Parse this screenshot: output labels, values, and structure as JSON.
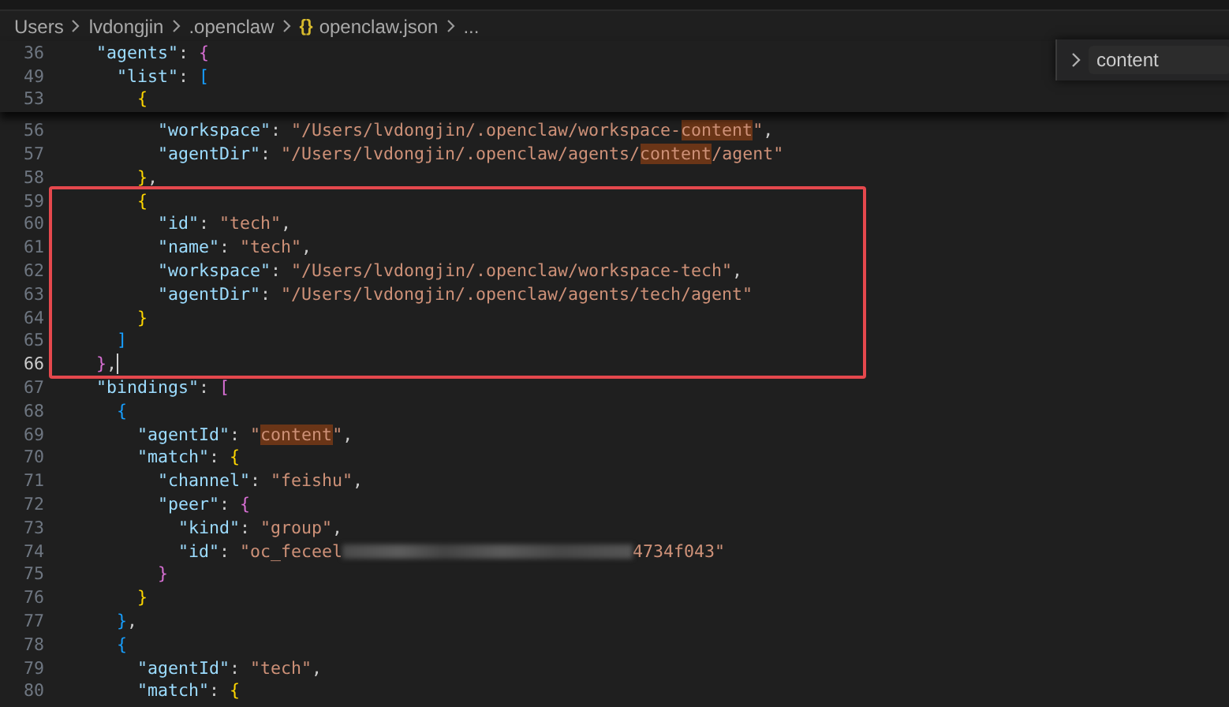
{
  "breadcrumbs": {
    "items": [
      "Users",
      "lvdongjin",
      ".openclaw"
    ],
    "file_icon": "{}",
    "file": "openclaw.json",
    "more": "..."
  },
  "find_widget": {
    "value": "content"
  },
  "sticky_scroll": [
    {
      "number": "36",
      "tokens": [
        {
          "kind": "key",
          "text": "\"agents\""
        },
        {
          "kind": "p",
          "text": ":"
        },
        {
          "kind": "b2",
          "text": "{"
        }
      ]
    },
    {
      "number": "49",
      "tokens": [
        {
          "kind": "key",
          "text": "\"list\""
        },
        {
          "kind": "p",
          "text": ":"
        },
        {
          "kind": "b3",
          "text": "["
        }
      ]
    },
    {
      "number": "53",
      "tokens": [
        {
          "kind": "b1",
          "text": "{"
        }
      ]
    }
  ],
  "lines_above_frame": [
    {
      "number": "56",
      "current": false,
      "tokens": [
        {
          "kind": "key",
          "text": "\"workspace\""
        },
        {
          "kind": "p",
          "text": ":"
        },
        {
          "kind": "str",
          "text": "\"/Users/lvdongjin/.openclaw/workspace-"
        },
        {
          "kind": "match",
          "text": "content"
        },
        {
          "kind": "str",
          "text": "\""
        },
        {
          "kind": "p",
          "text": ","
        }
      ]
    },
    {
      "number": "57",
      "current": false,
      "tokens": [
        {
          "kind": "key",
          "text": "\"agentDir\""
        },
        {
          "kind": "p",
          "text": ":"
        },
        {
          "kind": "str",
          "text": "\"/Users/lvdongjin/.openclaw/agents/"
        },
        {
          "kind": "match",
          "text": "content"
        },
        {
          "kind": "str",
          "text": "/agent\""
        }
      ]
    },
    {
      "number": "58",
      "current": false,
      "tokens": [
        {
          "kind": "b1",
          "text": "}"
        },
        {
          "kind": "p",
          "text": ","
        }
      ]
    }
  ],
  "framed_lines": [
    {
      "number": "59",
      "current": false,
      "tokens": [
        {
          "kind": "b1",
          "text": "{"
        }
      ]
    },
    {
      "number": "60",
      "current": false,
      "tokens": [
        {
          "kind": "key",
          "text": "\"id\""
        },
        {
          "kind": "p",
          "text": ":"
        },
        {
          "kind": "str",
          "text": "\"tech\""
        },
        {
          "kind": "p",
          "text": ","
        }
      ]
    },
    {
      "number": "61",
      "current": false,
      "tokens": [
        {
          "kind": "key",
          "text": "\"name\""
        },
        {
          "kind": "p",
          "text": ":"
        },
        {
          "kind": "str",
          "text": "\"tech\""
        },
        {
          "kind": "p",
          "text": ","
        }
      ]
    },
    {
      "number": "62",
      "current": false,
      "tokens": [
        {
          "kind": "key",
          "text": "\"workspace\""
        },
        {
          "kind": "p",
          "text": ":"
        },
        {
          "kind": "str",
          "text": "\"/Users/lvdongjin/.openclaw/workspace-tech\""
        },
        {
          "kind": "p",
          "text": ","
        }
      ]
    },
    {
      "number": "63",
      "current": false,
      "tokens": [
        {
          "kind": "key",
          "text": "\"agentDir\""
        },
        {
          "kind": "p",
          "text": ":"
        },
        {
          "kind": "str",
          "text": "\"/Users/lvdongjin/.openclaw/agents/tech/agent\""
        }
      ]
    },
    {
      "number": "64",
      "current": false,
      "tokens": [
        {
          "kind": "b1",
          "text": "}"
        }
      ]
    },
    {
      "number": "65",
      "current": false,
      "tokens": [
        {
          "kind": "b3",
          "text": "]"
        }
      ]
    },
    {
      "number": "66",
      "current": true,
      "tokens": [
        {
          "kind": "b2",
          "text": "}"
        },
        {
          "kind": "p",
          "text": ","
        }
      ]
    }
  ],
  "lines_below_frame": [
    {
      "number": "67",
      "current": false,
      "tokens": [
        {
          "kind": "key",
          "text": "\"bindings\""
        },
        {
          "kind": "p",
          "text": ":"
        },
        {
          "kind": "b2",
          "text": "["
        }
      ]
    },
    {
      "number": "68",
      "current": false,
      "tokens": [
        {
          "kind": "b3",
          "text": "{"
        }
      ]
    },
    {
      "number": "69",
      "current": false,
      "tokens": [
        {
          "kind": "key",
          "text": "\"agentId\""
        },
        {
          "kind": "p",
          "text": ":"
        },
        {
          "kind": "str",
          "text": "\""
        },
        {
          "kind": "match",
          "text": "content"
        },
        {
          "kind": "str",
          "text": "\""
        },
        {
          "kind": "p",
          "text": ","
        }
      ]
    },
    {
      "number": "70",
      "current": false,
      "tokens": [
        {
          "kind": "key",
          "text": "\"match\""
        },
        {
          "kind": "p",
          "text": ":"
        },
        {
          "kind": "b1",
          "text": "{"
        }
      ]
    },
    {
      "number": "71",
      "current": false,
      "tokens": [
        {
          "kind": "key",
          "text": "\"channel\""
        },
        {
          "kind": "p",
          "text": ":"
        },
        {
          "kind": "str",
          "text": "\"feishu\""
        },
        {
          "kind": "p",
          "text": ","
        }
      ]
    },
    {
      "number": "72",
      "current": false,
      "tokens": [
        {
          "kind": "key",
          "text": "\"peer\""
        },
        {
          "kind": "p",
          "text": ":"
        },
        {
          "kind": "b2",
          "text": "{"
        }
      ]
    },
    {
      "number": "73",
      "current": false,
      "tokens": [
        {
          "kind": "key",
          "text": "\"kind\""
        },
        {
          "kind": "p",
          "text": ":"
        },
        {
          "kind": "str",
          "text": "\"group\""
        },
        {
          "kind": "p",
          "text": ","
        }
      ]
    },
    {
      "number": "74",
      "current": false,
      "tokens": [
        {
          "kind": "key",
          "text": "\"id\""
        },
        {
          "kind": "p",
          "text": ":"
        },
        {
          "kind": "str",
          "text": "\"oc_feceel"
        },
        {
          "kind": "redacted"
        },
        {
          "kind": "str",
          "text": "4734f043\""
        }
      ]
    },
    {
      "number": "75",
      "current": false,
      "tokens": [
        {
          "kind": "b2",
          "text": "}"
        }
      ]
    },
    {
      "number": "76",
      "current": false,
      "tokens": [
        {
          "kind": "b1",
          "text": "}"
        }
      ]
    },
    {
      "number": "77",
      "current": false,
      "tokens": [
        {
          "kind": "b3",
          "text": "}"
        },
        {
          "kind": "p",
          "text": ","
        }
      ]
    },
    {
      "number": "78",
      "current": false,
      "tokens": [
        {
          "kind": "b3",
          "text": "{"
        }
      ]
    },
    {
      "number": "79",
      "current": false,
      "tokens": [
        {
          "kind": "key",
          "text": "\"agentId\""
        },
        {
          "kind": "p",
          "text": ":"
        },
        {
          "kind": "str",
          "text": "\"tech\""
        },
        {
          "kind": "p",
          "text": ","
        }
      ]
    },
    {
      "number": "80",
      "current": false,
      "tokens": [
        {
          "kind": "key",
          "text": "\"match\""
        },
        {
          "kind": "p",
          "text": ":"
        },
        {
          "kind": "b1",
          "text": "{"
        }
      ]
    }
  ]
}
